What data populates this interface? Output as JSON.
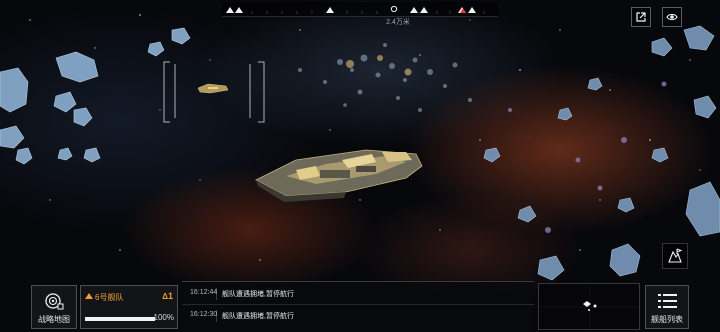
{
  "navigation": {
    "distance": "2.4万米"
  },
  "top_right": {
    "share_icon": "external-link-icon",
    "view_icon": "eye-icon"
  },
  "map_button": {
    "icon": "map-flag-icon"
  },
  "bottom": {
    "strategy_map_label": "战略地图",
    "fleet": {
      "name": "6号舰队",
      "status": "1",
      "hp_percent": 100,
      "hp_text": "100%"
    },
    "logs": [
      {
        "time": "16:12:44",
        "message": "舰队遭遇拥堵,暂停航行"
      },
      {
        "time": "16:12:30",
        "message": "舰队遭遇拥堵,暂停航行"
      }
    ],
    "ship_list_label": "舰船列表"
  },
  "colors": {
    "accent_orange": "#f0a030",
    "hud_white": "#e6e8ea"
  }
}
